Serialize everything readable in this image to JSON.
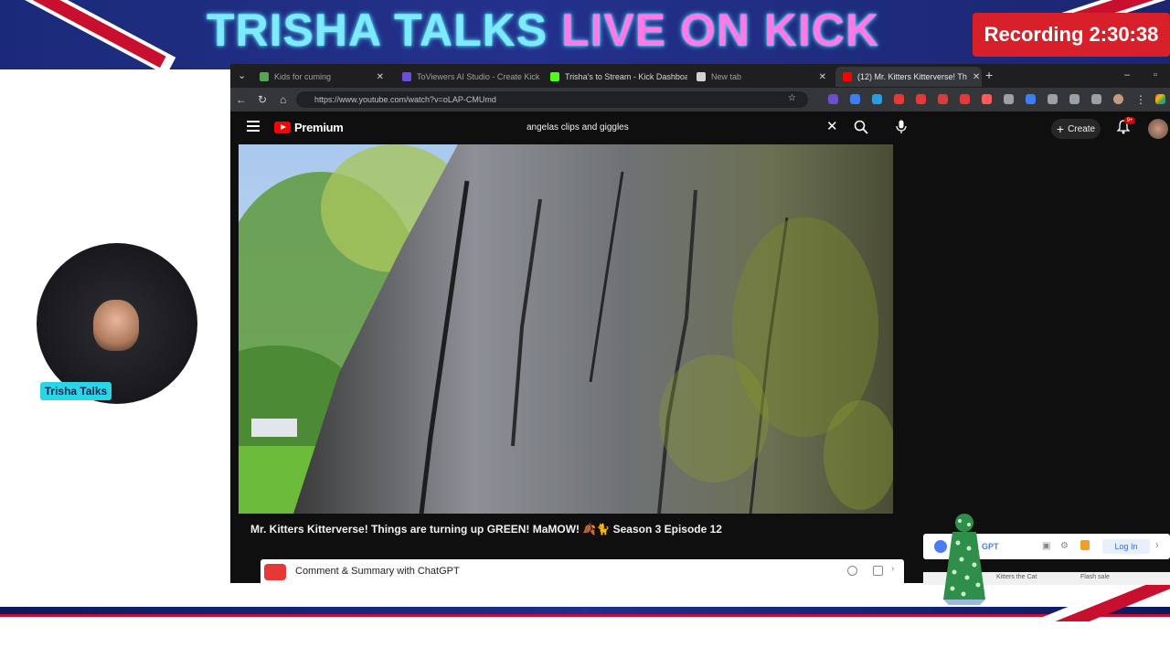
{
  "banner": {
    "title_part1": "TRISHA TALKS",
    "title_part2": "LIVE ON KICK",
    "recording": "Recording 2:30:38"
  },
  "webcam": {
    "name_tag": "Trisha Talks"
  },
  "browser": {
    "tabs": [
      {
        "label": "Kids for cuming",
        "active": false
      },
      {
        "label": "ToViewers AI Studio - Create Kick",
        "active": false
      },
      {
        "label": "Trisha's to Stream - Kick Dashboard",
        "active": false
      },
      {
        "label": "New tab",
        "active": false
      },
      {
        "label": "(12) Mr. Kitters Kitterverse! Th",
        "active": true
      }
    ],
    "url": "https://www.youtube.com/watch?v=oLAP-CMUmd"
  },
  "youtube": {
    "logo_text": "Premium",
    "search_query": "angelas clips and giggles",
    "create_label": "Create",
    "notif_count": "9+",
    "video_title": "Mr. Kitters Kitterverse! Things are turning up GREEN! MaMOW! 🍂🐈 Season 3 Episode 12",
    "chatgpt_label": "Comment & Summary with ChatGPT"
  },
  "plugin": {
    "gpt_text": "GPT",
    "login_label": "Log In",
    "row2_items": [
      "Kitters the Cat",
      "Flash sale"
    ]
  },
  "colors": {
    "banner_bg": "#1b2a78",
    "recording_bg": "#d8202a",
    "name_tag_bg": "#2bd5e6",
    "youtube_red": "#ff0000"
  }
}
